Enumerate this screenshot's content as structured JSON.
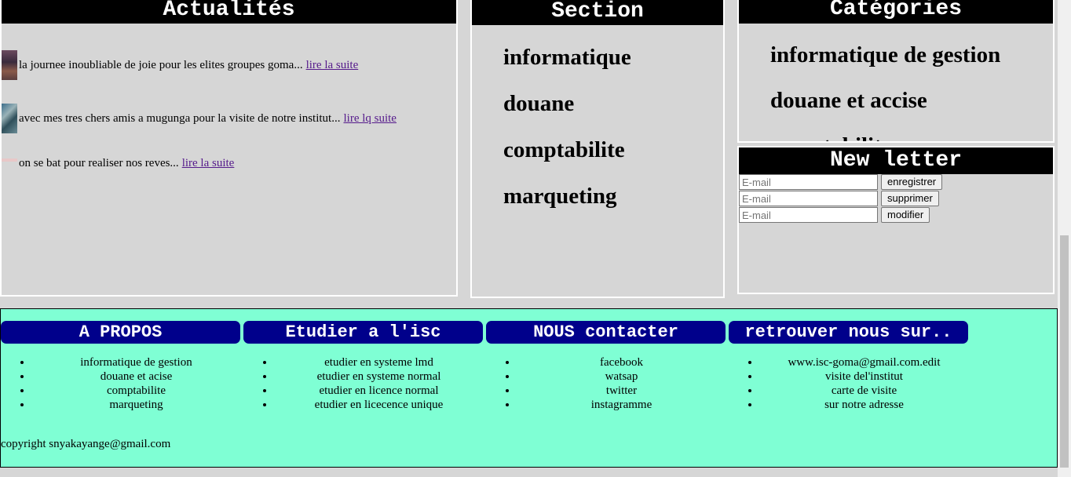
{
  "actualites": {
    "title": "Actualités",
    "items": [
      {
        "text": "la journee inoubliable de joie pour les elites groupes goma...",
        "link": "lire la suite"
      },
      {
        "text": "avec mes tres chers amis a mugunga pour la visite de notre institut...",
        "link": "lire lq suite"
      },
      {
        "text": "on se bat pour realiser nos reves...",
        "link": "lire la suite"
      }
    ]
  },
  "section": {
    "title": "Section",
    "items": [
      "informatique",
      "douane",
      "comptabilite",
      "marqueting"
    ]
  },
  "categories": {
    "title": "Catégories",
    "items": [
      "informatique de gestion",
      "douane et accise",
      "comptabilite"
    ]
  },
  "newsletter": {
    "title": "New letter",
    "placeholder": "E-mail",
    "buttons": [
      "enregistrer",
      "supprimer",
      "modifier"
    ]
  },
  "footer": {
    "columns": [
      {
        "title": "A PROPOS",
        "items": [
          "informatique de gestion",
          "douane et acise",
          "comptabilite",
          "marqueting"
        ]
      },
      {
        "title": "Etudier a l'isc",
        "items": [
          "etudier en systeme lmd",
          "etudier en systeme normal",
          "etudier en licence normal",
          "etudier en licecence unique"
        ]
      },
      {
        "title": "NOUS contacter",
        "items": [
          "facebook",
          "watsap",
          "twitter",
          "instagramme"
        ]
      },
      {
        "title": "retrouver nous sur..",
        "items": [
          "www.isc-goma@gmail.com.edit",
          "visite del'institut",
          "carte de visite",
          "sur notre adresse"
        ]
      }
    ],
    "copyright": "copyright snyakayange@gmail.com"
  }
}
